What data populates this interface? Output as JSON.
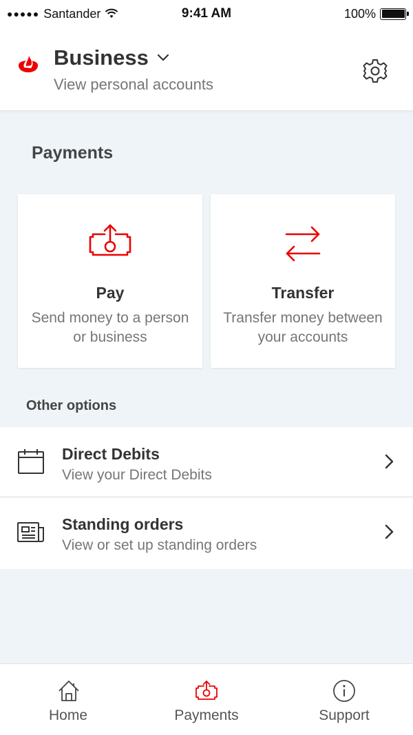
{
  "status_bar": {
    "signal_dots": "●●●●●",
    "carrier": "Santander",
    "time": "9:41 AM",
    "battery": "100%",
    "battery_level": 1.0
  },
  "header": {
    "title": "Business",
    "subtitle": "View personal accounts",
    "logo_icon": "santander-flame-icon",
    "settings_icon": "gear-icon"
  },
  "payments": {
    "title": "Payments",
    "cards": [
      {
        "title": "Pay",
        "description": "Send money to a person or business",
        "icon": "pay-money-icon"
      },
      {
        "title": "Transfer",
        "description": "Transfer money between your accounts",
        "icon": "transfer-arrows-icon"
      }
    ]
  },
  "other_options": {
    "title": "Other options",
    "items": [
      {
        "title": "Direct Debits",
        "subtitle": "View your Direct Debits",
        "icon": "calendar-icon"
      },
      {
        "title": "Standing orders",
        "subtitle": "View or set up standing orders",
        "icon": "newspaper-icon"
      }
    ]
  },
  "tabbar": {
    "tabs": [
      {
        "label": "Home",
        "icon": "home-icon",
        "active": false
      },
      {
        "label": "Payments",
        "icon": "pay-money-icon",
        "active": true
      },
      {
        "label": "Support",
        "icon": "info-icon",
        "active": false
      }
    ]
  },
  "colors": {
    "brand_red": "#ec0000",
    "background": "#eef4f7",
    "text_dark": "#333333",
    "text_muted": "#767676"
  }
}
